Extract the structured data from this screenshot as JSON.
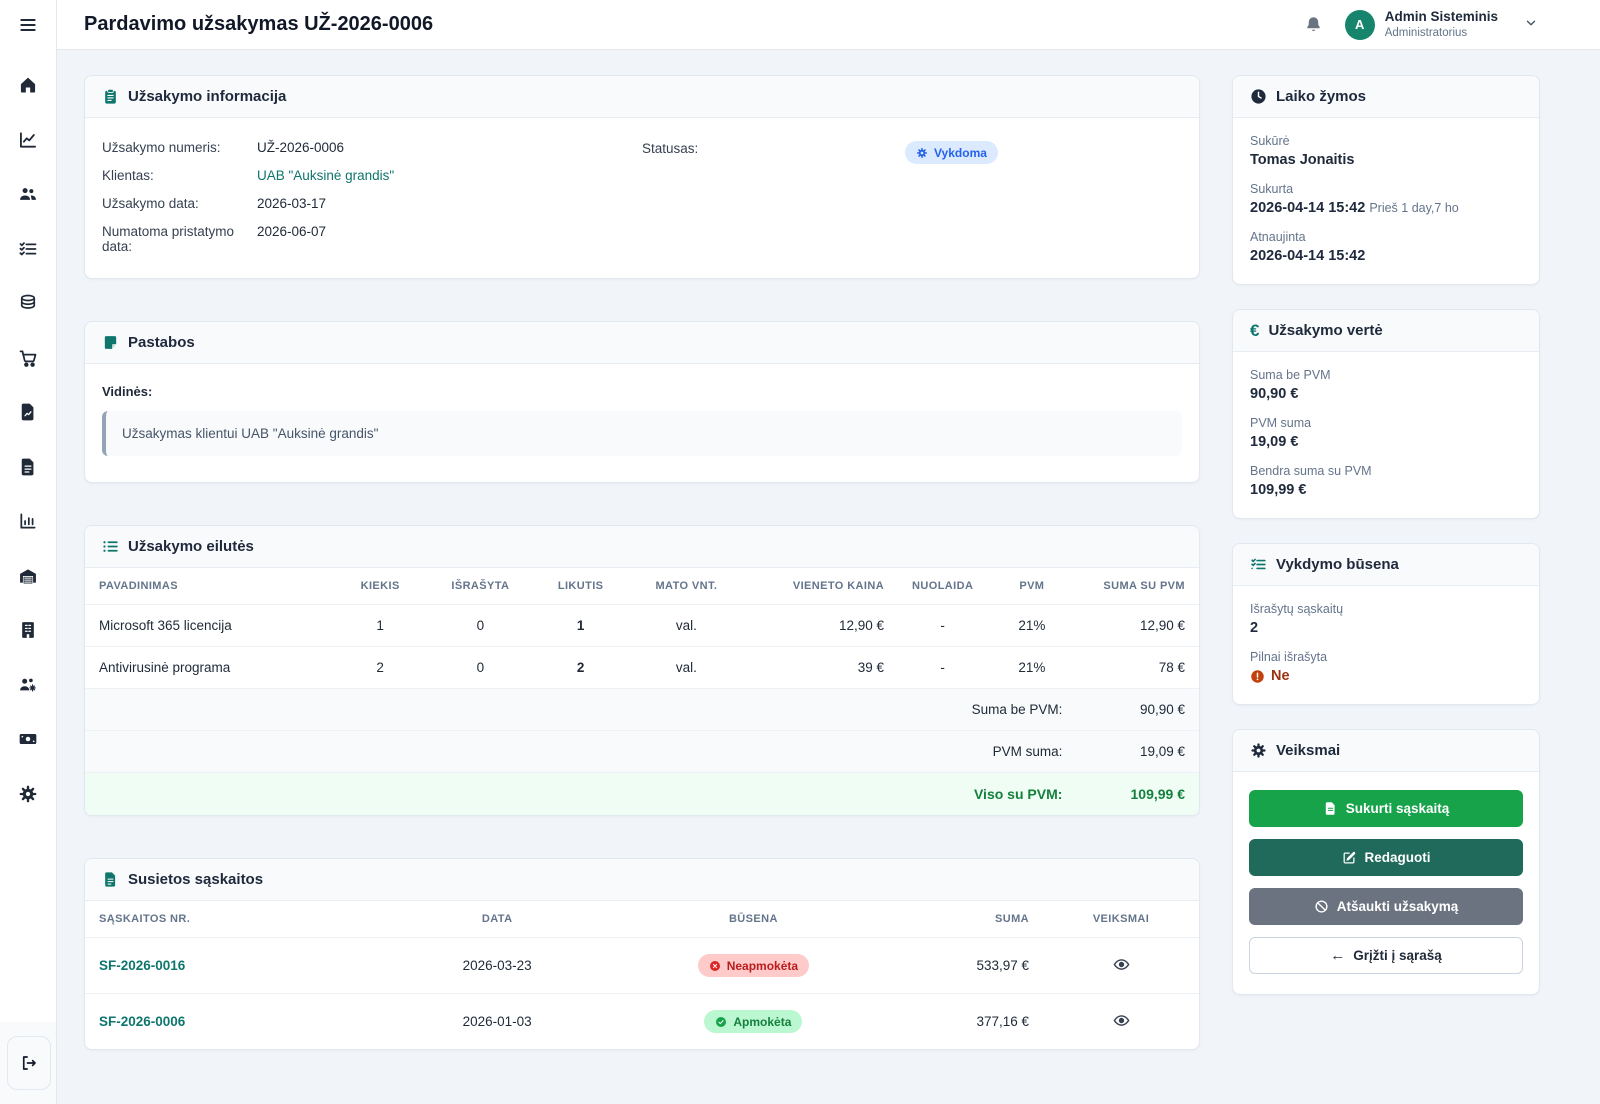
{
  "topbar": {
    "title": "Pardavimo užsakymas UŽ-2026-0006",
    "user_name": "Admin Sisteminis",
    "user_role": "Administratorius",
    "avatar_initial": "A"
  },
  "sidebar": {
    "icons": [
      "menu-icon",
      "home-icon",
      "analytics-icon",
      "clients-icon",
      "orders-icon",
      "products-icon",
      "purchases-icon",
      "report-file-icon",
      "documents-icon",
      "bar-chart-icon",
      "warehouse-icon",
      "company-icon",
      "hr-icon",
      "finance-icon",
      "settings-icon",
      "logout-icon"
    ]
  },
  "order_info": {
    "title": "Užsakymo informacija",
    "fields": [
      {
        "label": "Užsakymo numeris:",
        "value": "UŽ-2026-0006"
      },
      {
        "label": "Klientas:",
        "value": "UAB \"Auksinė grandis\""
      },
      {
        "label": "Užsakymo data:",
        "value": "2026-03-17"
      },
      {
        "label": "Numatoma pristatymo data:",
        "value": "2026-06-07"
      }
    ],
    "status_label": "Statusas:",
    "status_value": "Vykdoma"
  },
  "notes": {
    "title": "Pastabos",
    "internal_label": "Vidinės:",
    "text": "Užsakymas klientui UAB \"Auksinė grandis\""
  },
  "lines": {
    "title": "Užsakymo eilutės",
    "columns": [
      "Pavadinimas",
      "Kiekis",
      "Išrašyta",
      "Likutis",
      "Mato vnt.",
      "Vieneto kaina",
      "Nuolaida",
      "PVM",
      "Suma su PVM"
    ],
    "rows": [
      {
        "name": "Microsoft 365 licencija",
        "qty": "1",
        "invoiced": "0",
        "remaining": "1",
        "unit": "val.",
        "price": "12,90 €",
        "discount": "-",
        "vat": "21%",
        "total": "12,90 €"
      },
      {
        "name": "Antivirusinė programa",
        "qty": "2",
        "invoiced": "0",
        "remaining": "2",
        "unit": "val.",
        "price": "39 €",
        "discount": "-",
        "vat": "21%",
        "total": "78 €"
      }
    ],
    "subtotal_label": "Suma be PVM:",
    "subtotal": "90,90 €",
    "vat_label": "PVM suma:",
    "vat": "19,09 €",
    "total_label": "Viso su PVM:",
    "total": "109,99 €"
  },
  "invoices": {
    "title": "Susietos sąskaitos",
    "columns": [
      "Sąskaitos nr.",
      "Data",
      "Būsena",
      "Suma",
      "Veiksmai"
    ],
    "rows": [
      {
        "number": "SF-2026-0016",
        "date": "2026-03-23",
        "status": "Neapmokėta",
        "status_type": "unpaid",
        "amount": "533,97 €"
      },
      {
        "number": "SF-2026-0006",
        "date": "2026-01-03",
        "status": "Apmokėta",
        "status_type": "paid",
        "amount": "377,16 €"
      }
    ]
  },
  "timestamps": {
    "title": "Laiko žymos",
    "created_by_label": "Sukūrė",
    "created_by": "Tomas Jonaitis",
    "created_label": "Sukurta",
    "created_value": "2026-04-14 15:42",
    "created_ago": "Prieš 1 day,7 ho",
    "updated_label": "Atnaujinta",
    "updated_value": "2026-04-14 15:42"
  },
  "value_card": {
    "title": "Užsakymo vertė",
    "subtotal_label": "Suma be PVM",
    "subtotal": "90,90 €",
    "vat_label": "PVM suma",
    "vat": "19,09 €",
    "total_label": "Bendra suma su PVM",
    "total": "109,99 €"
  },
  "execution": {
    "title": "Vykdymo būsena",
    "invoices_label": "Išrašytų sąskaitų",
    "invoices_count": "2",
    "fully_label": "Pilnai išrašyta",
    "fully_value": "Ne"
  },
  "actions": {
    "title": "Veiksmai",
    "create_invoice": "Sukurti sąskaitą",
    "edit": "Redaguoti",
    "cancel": "Atšaukti užsakymą",
    "back": "Grįžti į sąrašą"
  },
  "colors": {
    "accent_teal": "#0f766e",
    "button_green": "#16a34a",
    "button_teal": "#1f6a5a",
    "button_gray": "#6b7280",
    "status_blue": "#2563eb",
    "success_green": "#15803d",
    "danger_red": "#b91c1c",
    "warning_orange": "#c2410c",
    "avatar_teal": "#16856c"
  }
}
